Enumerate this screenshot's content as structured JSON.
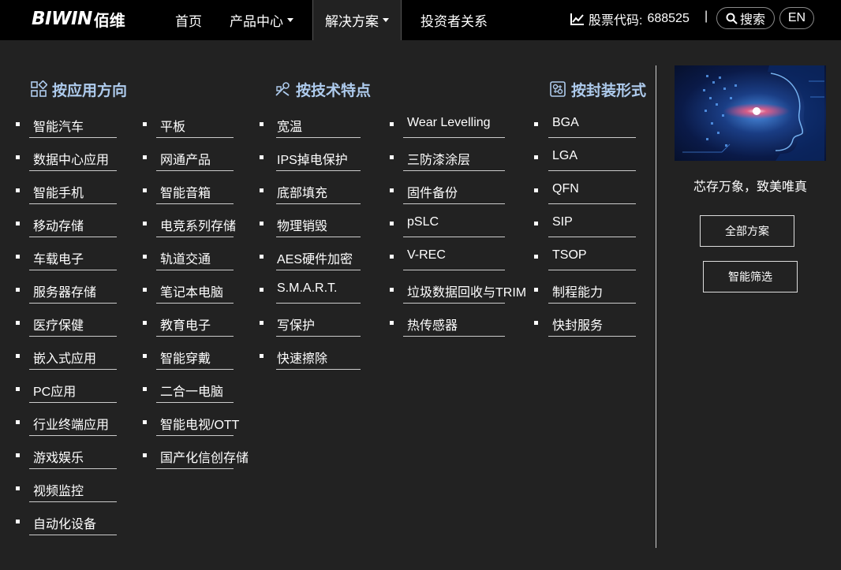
{
  "nav": {
    "logo_latin": "BIWIN",
    "logo_cn": "佰维",
    "items": [
      {
        "label": "首页",
        "dropdown": false
      },
      {
        "label": "产品中心",
        "dropdown": true
      },
      {
        "label": "解决方案",
        "dropdown": true,
        "active": true
      },
      {
        "label": "投资者关系",
        "dropdown": false
      }
    ],
    "stock_label": "股票代码:",
    "stock_code": "688525",
    "separator": "|",
    "search_label": "搜索",
    "lang_label": "EN"
  },
  "menu": {
    "sections": [
      {
        "title": "按应用方向",
        "icon": "grid-icon"
      },
      {
        "title": "按技术特点",
        "icon": "tools-icon"
      },
      {
        "title": "按封装形式",
        "icon": "chip-icon"
      }
    ],
    "application_col1": [
      "智能汽车",
      "数据中心应用",
      "智能手机",
      "移动存储",
      "车载电子",
      "服务器存储",
      "医疗保健",
      "嵌入式应用",
      "PC应用",
      "行业终端应用",
      "游戏娱乐",
      "视频监控",
      "自动化设备"
    ],
    "application_col2": [
      "平板",
      "网通产品",
      "智能音箱",
      "电竞系列存储",
      "轨道交通",
      "笔记本电脑",
      "教育电子",
      "智能穿戴",
      "二合一电脑",
      "智能电视/OTT",
      "国产化信创存储"
    ],
    "tech_col1": [
      "宽温",
      "IPS掉电保护",
      "底部填充",
      "物理销毁",
      "AES硬件加密",
      "S.M.A.R.T.",
      "写保护",
      "快速擦除"
    ],
    "tech_col2": [
      "Wear Levelling",
      "三防漆涂层",
      "固件备份",
      "pSLC",
      "V-REC",
      "垃圾数据回收与TRIM",
      "热传感器"
    ],
    "package_col": [
      "BGA",
      "LGA",
      "QFN",
      "SIP",
      "TSOP",
      "制程能力",
      "快封服务"
    ]
  },
  "promo": {
    "slogan": "芯存万象，致美唯真",
    "all_solutions_label": "全部方案",
    "smart_filter_label": "智能筛选"
  },
  "colors": {
    "nav_bg": "#000000",
    "menu_bg": "#222222",
    "section_title": "#aecbed"
  }
}
